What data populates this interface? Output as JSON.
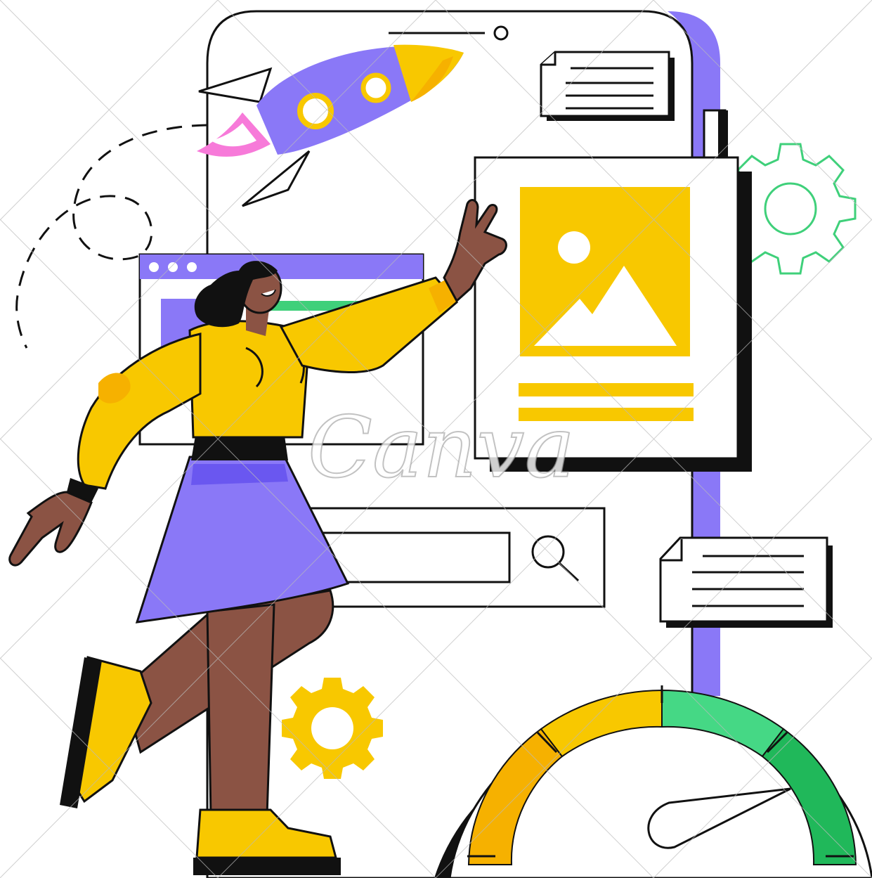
{
  "illustration": {
    "subject": "woman-interacting-with-phone-ui",
    "colors": {
      "outline": "#111111",
      "purple": "#8a78f7",
      "yellow": "#f8c800",
      "orange": "#f6b100",
      "green": "#3fd07a",
      "dark_green": "#20b85a",
      "skin": "#8b5344",
      "pink": "#f77ad9",
      "white": "#ffffff"
    },
    "gauge": {
      "segments": [
        "orange",
        "yellow",
        "light-green",
        "dark-green"
      ],
      "level": 0.82
    },
    "browser_window": {
      "dots": 3
    },
    "search_bar": {
      "icon": "magnifier-icon"
    },
    "image_card": {
      "icon": "image-placeholder-icon"
    },
    "gears": [
      "gear-icon",
      "gear-outline-icon"
    ],
    "rocket": {
      "portholes": 2
    }
  },
  "watermark": {
    "text": "Canva"
  }
}
